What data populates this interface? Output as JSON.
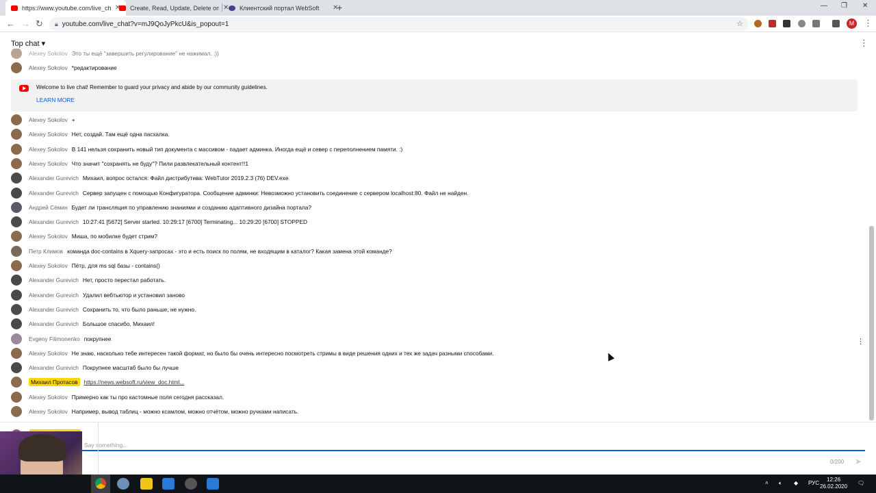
{
  "browser": {
    "tabs": [
      {
        "title": "https://www.youtube.com/live_ch",
        "favicon_color": "#ff0000"
      },
      {
        "title": "Create, Read, Update, Delete one",
        "favicon_color": "#ff0000"
      },
      {
        "title": "Клиентский портал WebSoft",
        "favicon_color": "#4a3f8f"
      }
    ],
    "url": "youtube.com/live_chat?v=mJ9QoJyPkcU&is_popout=1",
    "profile_initial": "M"
  },
  "chat": {
    "title": "Top chat",
    "banner": {
      "text": "Welcome to live chat! Remember to guard your privacy and abide by our community guidelines.",
      "learn_more": "LEARN MORE"
    },
    "messages_top": [
      {
        "author": "Alexey Sokolov",
        "text": "Это ты ещё \"завершить регулирование\" не нажимал. :))"
      },
      {
        "author": "Alexey Sokolov",
        "text": "*редактирование"
      }
    ],
    "messages": [
      {
        "author": "Alexey Sokolov",
        "text": "+"
      },
      {
        "author": "Alexey Sokolov",
        "text": "Нет, создай. Там ещё одна пасхалка."
      },
      {
        "author": "Alexey Sokolov",
        "text": "В 141 нельзя сохранить новый тип документа с массивом - падает админка. Иногда ещё и север с переполнением памяти. :)"
      },
      {
        "author": "Alexey Sokolov",
        "text": "Что значит \"сохранять не буду\"? Пили развлекательный контент!!1"
      },
      {
        "author": "Alexander Gurevich",
        "text": "Михаил, вопрос остался: Файл дистрибутива: WebTutor 2019.2.3 (76) DEV.exe"
      },
      {
        "author": "Alexander Gurevich",
        "text": "Сервер запущен с помощью Конфигуратора. Сообщение админки: Невозможно установить соединение с сервером localhost:80. Файл не найден."
      },
      {
        "author": "Андрей Сёмин",
        "text": "Будет ли трансляция по управлению знаниями и созданию адаптивного дизайна портала?"
      },
      {
        "author": "Alexander Gurevich",
        "text": "10:27:41 [5672] Server started. 10:29:17 [6700] Terminating... 10:29:20 [6700] STOPPED"
      },
      {
        "author": "Alexey Sokolov",
        "text": "Миша, по мобилке будет стрим?"
      },
      {
        "author": "Петр Климов",
        "text": "команда doc-contains в Xquery-запросах - это и есть поиск по полям, не входящим в каталог? Какая замена этой команде?"
      },
      {
        "author": "Alexey Sokolov",
        "text": "Пётр, для ms sql базы - contains()"
      },
      {
        "author": "Alexander Gurevich",
        "text": "Нет, просто перестал работать."
      },
      {
        "author": "Alexander Gurevich",
        "text": "Удалил вебтьютор и установил заново"
      },
      {
        "author": "Alexander Gurevich",
        "text": "Сохранить то, что было раньше, не нужно."
      },
      {
        "author": "Alexander Gurevich",
        "text": "Большое спасибо, Михаил!"
      },
      {
        "author": "Evgeny Filimonenko",
        "text": "покрупнее"
      },
      {
        "author": "Alexey Sokolov",
        "text": "Не знаю, насколько тебе интересен такой формат, но было бы очень интересно посмотреть стримы в виде решения одних и тех же задач разными способами."
      },
      {
        "author": "Alexander Gurevich",
        "text": "Покрупнее масштаб было бы лучше"
      },
      {
        "author": "Михаил Протасов",
        "text": "https://news.websoft.ru/view_doc.html...",
        "owner": true
      },
      {
        "author": "Alexey Sokolov",
        "text": "Примерно как ты про кастомные поля сегодня рассказал."
      },
      {
        "author": "Alexey Sokolov",
        "text": "Например, вывод таблиц - можно ксамлом, можно отчётом, можно ручками написать."
      }
    ],
    "composer": {
      "username": "Михаил Протасов",
      "placeholder": "Say something...",
      "counter": "0/200"
    }
  },
  "taskbar": {
    "lang": "РУС",
    "time": "12:26",
    "date": "26.02.2020"
  },
  "colors": {
    "owner_badge": "#ffd600",
    "link_blue": "#065fd4",
    "yt_red": "#ff0000"
  }
}
